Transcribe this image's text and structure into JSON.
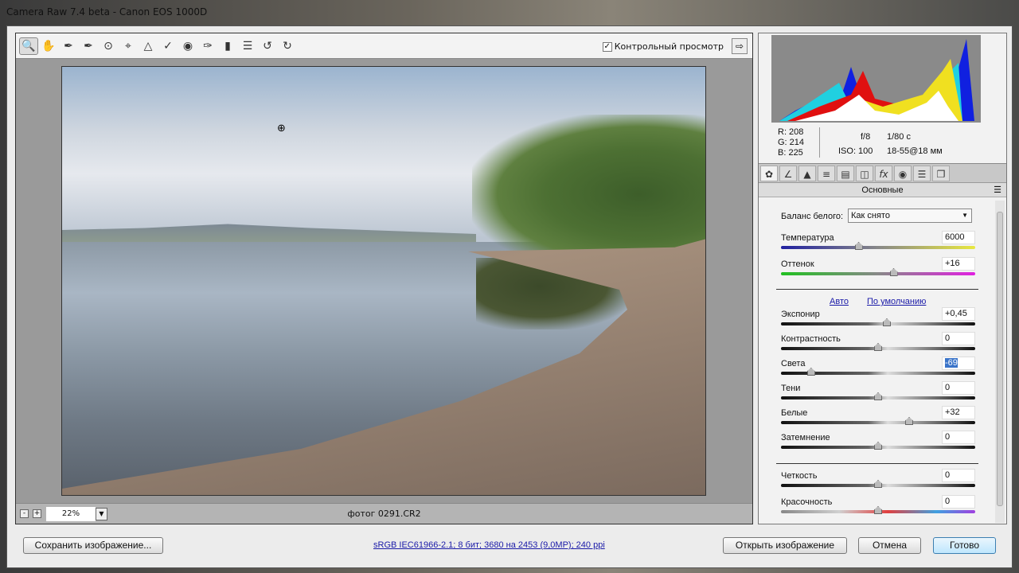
{
  "window": {
    "title": "Camera Raw 7.4 beta  -  Canon EOS 1000D"
  },
  "toolbar": {
    "tools": [
      "zoom-icon",
      "hand-icon",
      "white-balance-icon",
      "color-sampler-icon",
      "targeted-adjustment-icon",
      "crop-icon",
      "straighten-icon",
      "spot-removal-icon",
      "red-eye-icon",
      "adjustment-brush-icon",
      "graduated-filter-icon",
      "preferences-icon",
      "rotate-left-icon",
      "rotate-right-icon"
    ],
    "preview_label": "Контрольный просмотр",
    "preview_checked": true
  },
  "status": {
    "zoom": "22%",
    "filename": "фотог 0291.CR2"
  },
  "readout": {
    "r": "R:  208",
    "g": "G:  214",
    "b": "B:  225",
    "aperture": "f/8",
    "shutter": "1/80 c",
    "iso": "ISO: 100",
    "lens": "18-55@18 мм"
  },
  "panel": {
    "section_title": "Основные",
    "wb_label": "Баланс белого:",
    "wb_value": "Как снято",
    "auto": "Авто",
    "default": "По умолчанию",
    "sliders": [
      {
        "label": "Температура",
        "value": "6000",
        "pos": 0.4
      },
      {
        "label": "Оттенок",
        "value": "+16",
        "pos": 0.58
      },
      {
        "label": "Экспонир",
        "value": "+0,45",
        "pos": 0.545
      },
      {
        "label": "Контрастность",
        "value": "0",
        "pos": 0.5
      },
      {
        "label": "Света",
        "value": "-69",
        "pos": 0.155
      },
      {
        "label": "Тени",
        "value": "0",
        "pos": 0.5
      },
      {
        "label": "Белые",
        "value": "+32",
        "pos": 0.66
      },
      {
        "label": "Затемнение",
        "value": "0",
        "pos": 0.5
      },
      {
        "label": "Четкость",
        "value": "0",
        "pos": 0.5
      },
      {
        "label": "Красочность",
        "value": "0",
        "pos": 0.5
      }
    ]
  },
  "bottom": {
    "save": "Сохранить изображение...",
    "info": "sRGB IEC61966-2.1; 8 бит; 3680 на 2453 (9,0MP); 240 ppi",
    "open": "Открыть изображение",
    "cancel": "Отмена",
    "done": "Готово"
  }
}
